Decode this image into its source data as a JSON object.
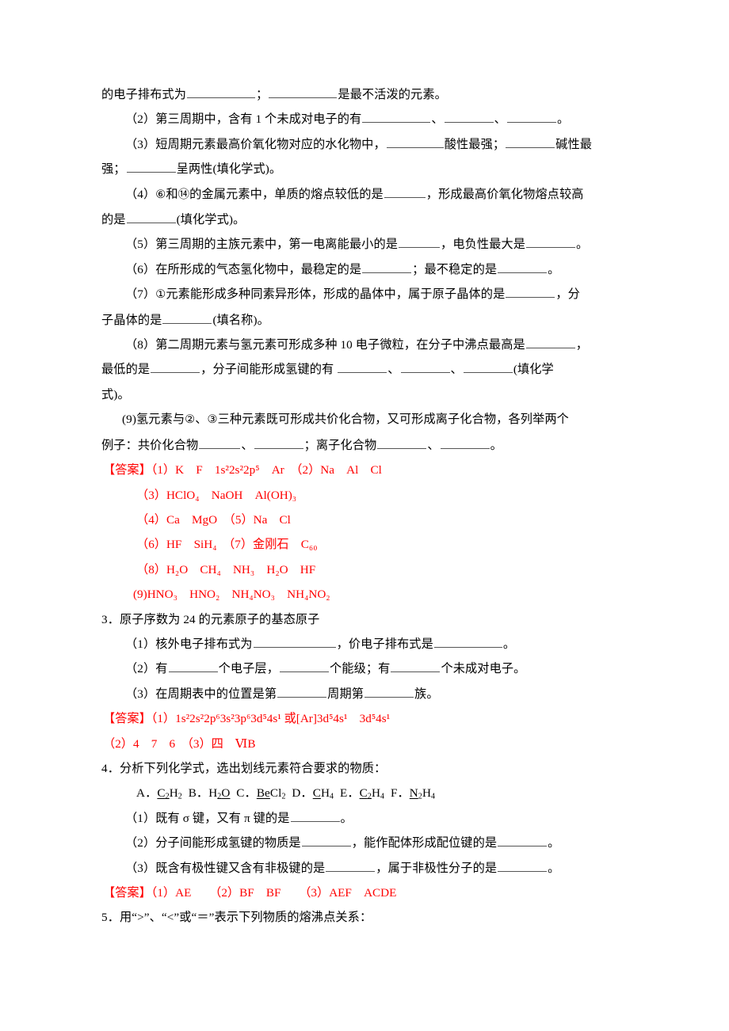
{
  "document": {
    "language": "zh-CN",
    "answer_color": "#ff0000",
    "body_color": "#000000"
  },
  "q2": {
    "line1_a": "的电子排布式为",
    "line1_b": "；",
    "line1_c": "是最不活泼的元素。",
    "item2_a": "（2）第三周期中，含有 1 个未成对电子的有",
    "item2_b": "、",
    "item2_c": "、",
    "item2_d": "。",
    "item3_a": "（3）短周期元素最高价氧化物对应的水化物中，",
    "item3_b": "酸性最强；",
    "item3_c": "碱性最",
    "item3_cont_a": "强；",
    "item3_cont_b": "呈两性(填化学式)。",
    "item4_a": "（4）",
    "item4_circ6": "⑥",
    "item4_b": "和",
    "item4_circ14": "⑭",
    "item4_c": "的金属元素中，单质的熔点较低的是",
    "item4_d": "，形成最高价氧化物熔点较高",
    "item4_cont_a": "的是",
    "item4_cont_b": "(填化学式)。",
    "item5_a": "（5）第三周期的主族元素中，第一电离能最小的是",
    "item5_b": "，电负性最大是",
    "item5_c": "。",
    "item6_a": "（6）在所形成的气态氢化物中，最稳定的是",
    "item6_b": "；最不稳定的是",
    "item6_c": "。",
    "item7_a": "（7）",
    "item7_circ1": "①",
    "item7_b": "元素能形成多种同素异形体，形成的晶体中，属于原子晶体的是",
    "item7_c": "，分",
    "item7_cont_a": "子晶体的是",
    "item7_cont_b": "(填名称)。",
    "item8_a": "（8）第二周期元素与氢元素可形成多种 10 电子微粒，在分子中沸点最高是",
    "item8_b": "，",
    "item8_cont_a": "最低的是",
    "item8_cont_b": "，分子间能形成氢键的有 ",
    "item8_cont_c": "、",
    "item8_cont_d": "、",
    "item8_cont_e": "(填化学",
    "item8_cont2": "式)。",
    "item9_a": "(9)氢元素与",
    "item9_circ2": "②",
    "item9_b": "、",
    "item9_circ3": "③",
    "item9_c": "三种元素既可形成共价化合物，又可形成离子化合物，各列举两个",
    "item9_cont_a": "例子：共价化合物",
    "item9_cont_b": "、",
    "item9_cont_c": "；离子化合物",
    "item9_cont_d": "、",
    "item9_cont_e": "。"
  },
  "a2": {
    "label": "【答案】",
    "l1": "（1）K　F　1s²2s²2p⁵　Ar　（2）Na　Al　Cl",
    "l2": "（3）HClO₄　NaOH　Al(OH)₃",
    "l3": "（4）Ca　MgO　（5）Na　Cl",
    "l4": "（6）HF　SiH₄　（7）金刚石　C₆₀",
    "l5": "（8）H₂O　CH₄　NH₃　H₂O　HF",
    "l6": "(9)HNO₃　HNO₂　NH₄NO₃　NH₄NO₂"
  },
  "q3": {
    "title": "3．原子序数为 24 的元素原子的基态原子",
    "item1_a": "（1）核外电子排布式为",
    "item1_b": "，价电子排布式是",
    "item1_c": "。",
    "item2_a": "（2）有",
    "item2_b": "个电子层，",
    "item2_c": "个能级；有",
    "item2_d": "个未成对电子。",
    "item3_a": "（3）在周期表中的位置是第",
    "item3_b": "周期第",
    "item3_c": "族。"
  },
  "a3": {
    "label": "【答案】",
    "l1": "（1）1s²2s²2p⁶3s²3p⁶3d⁵4s¹ 或[Ar]3d⁵4s¹　3d⁵4s¹",
    "l2": "（2）4　7　6　（3）四　ⅥB"
  },
  "q4": {
    "title": "4．分析下列化学式，选出划线元素符合要求的物质：",
    "options": [
      {
        "tag": "A．",
        "formula_html": "<span class=\"u\">C<sub>2</sub></span>H<sub>2</sub>"
      },
      {
        "tag": "B．",
        "formula_html": "H<span class=\"u\"><sub>2</sub>O</span>"
      },
      {
        "tag": "C．",
        "formula_html": "<span class=\"u\">Be</span>Cl<sub>2</sub>"
      },
      {
        "tag": "D．",
        "formula_html": "<span class=\"u\">C</span>H<sub>4</sub>"
      },
      {
        "tag": "E．",
        "formula_html": "<span class=\"u\">C<sub>2</sub></span>H<sub>4</sub>"
      },
      {
        "tag": "F．",
        "formula_html": "<span class=\"u\">N</span><sub>2</sub>H<sub>4</sub>"
      }
    ],
    "item1_a": "（1）既有 σ 键，又有 π 键的是",
    "item1_b": "。",
    "item2_a": "（2）分子间能形成氢键的物质是",
    "item2_b": "，能作配体形成配位键的是",
    "item2_c": "。",
    "item3_a": "（3）既含有极性键又含有非极键的是",
    "item3_b": "，属于非极性分子的是",
    "item3_c": "。"
  },
  "a4": {
    "label": "【答案】",
    "l1": "（1）AE　　（2）BF　BF　　（3）AEF　ACDE"
  },
  "q5": {
    "title": "5．用“>”、“<”或“＝”表示下列物质的熔沸点关系："
  }
}
